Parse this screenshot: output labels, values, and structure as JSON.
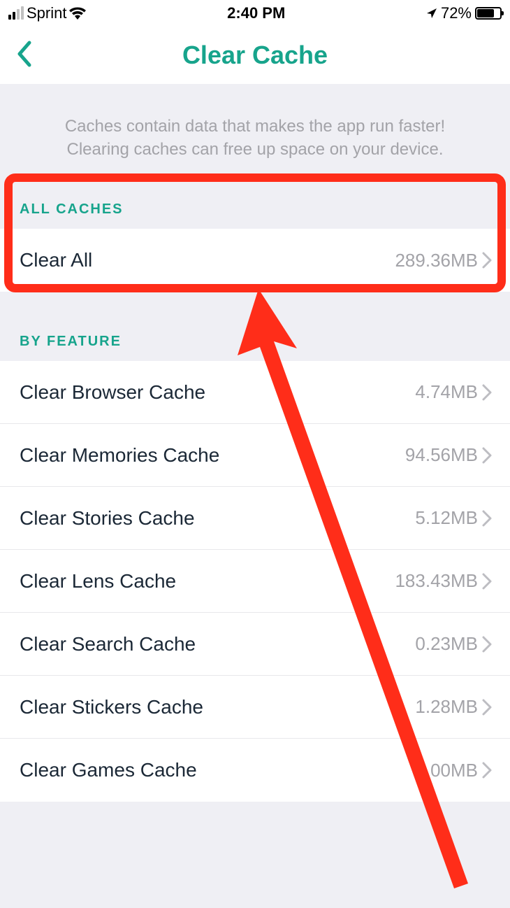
{
  "status": {
    "carrier": "Sprint",
    "time": "2:40 PM",
    "battery_percent": "72%"
  },
  "nav": {
    "title": "Clear Cache"
  },
  "description": {
    "line1": "Caches contain data that makes the app run faster!",
    "line2": "Clearing caches can free up space on your device."
  },
  "sections": {
    "all": {
      "header": "ALL CACHES",
      "items": [
        {
          "label": "Clear All",
          "value": "289.36MB"
        }
      ]
    },
    "byFeature": {
      "header": "BY FEATURE",
      "items": [
        {
          "label": "Clear Browser Cache",
          "value": "4.74MB"
        },
        {
          "label": "Clear Memories Cache",
          "value": "94.56MB"
        },
        {
          "label": "Clear Stories Cache",
          "value": "5.12MB"
        },
        {
          "label": "Clear Lens Cache",
          "value": "183.43MB"
        },
        {
          "label": "Clear Search Cache",
          "value": "0.23MB"
        },
        {
          "label": "Clear Stickers Cache",
          "value": "1.28MB"
        },
        {
          "label": "Clear Games Cache",
          "value": "0.00MB"
        }
      ]
    }
  }
}
